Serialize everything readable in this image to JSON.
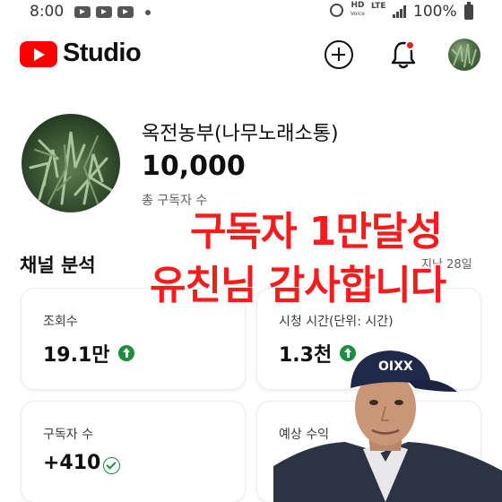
{
  "status_bar": {
    "time": "8:00",
    "hd_label": "HD",
    "voice_label": "Voice",
    "lte_label": "LTE",
    "battery": "100%"
  },
  "app_bar": {
    "app_name": "Studio"
  },
  "channel": {
    "name": "옥전농부(나무노래소통)",
    "subscriber_count": "10,000",
    "subscriber_label": "총 구독자 수"
  },
  "analytics": {
    "title": "채널 분석",
    "period": "지난 28일",
    "cards": [
      {
        "label": "조회수",
        "value": "19.1만",
        "trend": "up"
      },
      {
        "label": "시청 시간(단위: 시간)",
        "value": "1.3천",
        "trend": "up"
      },
      {
        "label": "구독자 수",
        "value": "+410",
        "trend": "check"
      },
      {
        "label": "예상 수익",
        "value": ""
      }
    ]
  },
  "overlay": {
    "line1": "구독자 1만달성",
    "line2": "유친님 감사합니다",
    "color": "#f41c1c"
  },
  "photo": {
    "cap_text": "OIXX"
  },
  "colors": {
    "brand_red": "#ff0000",
    "trend_green": "#1e8e3e",
    "notification_red": "#e0211d"
  },
  "icons": [
    "youtube-logo-icon",
    "create-icon",
    "bell-icon",
    "up-arrow-icon",
    "check-circle-icon"
  ]
}
